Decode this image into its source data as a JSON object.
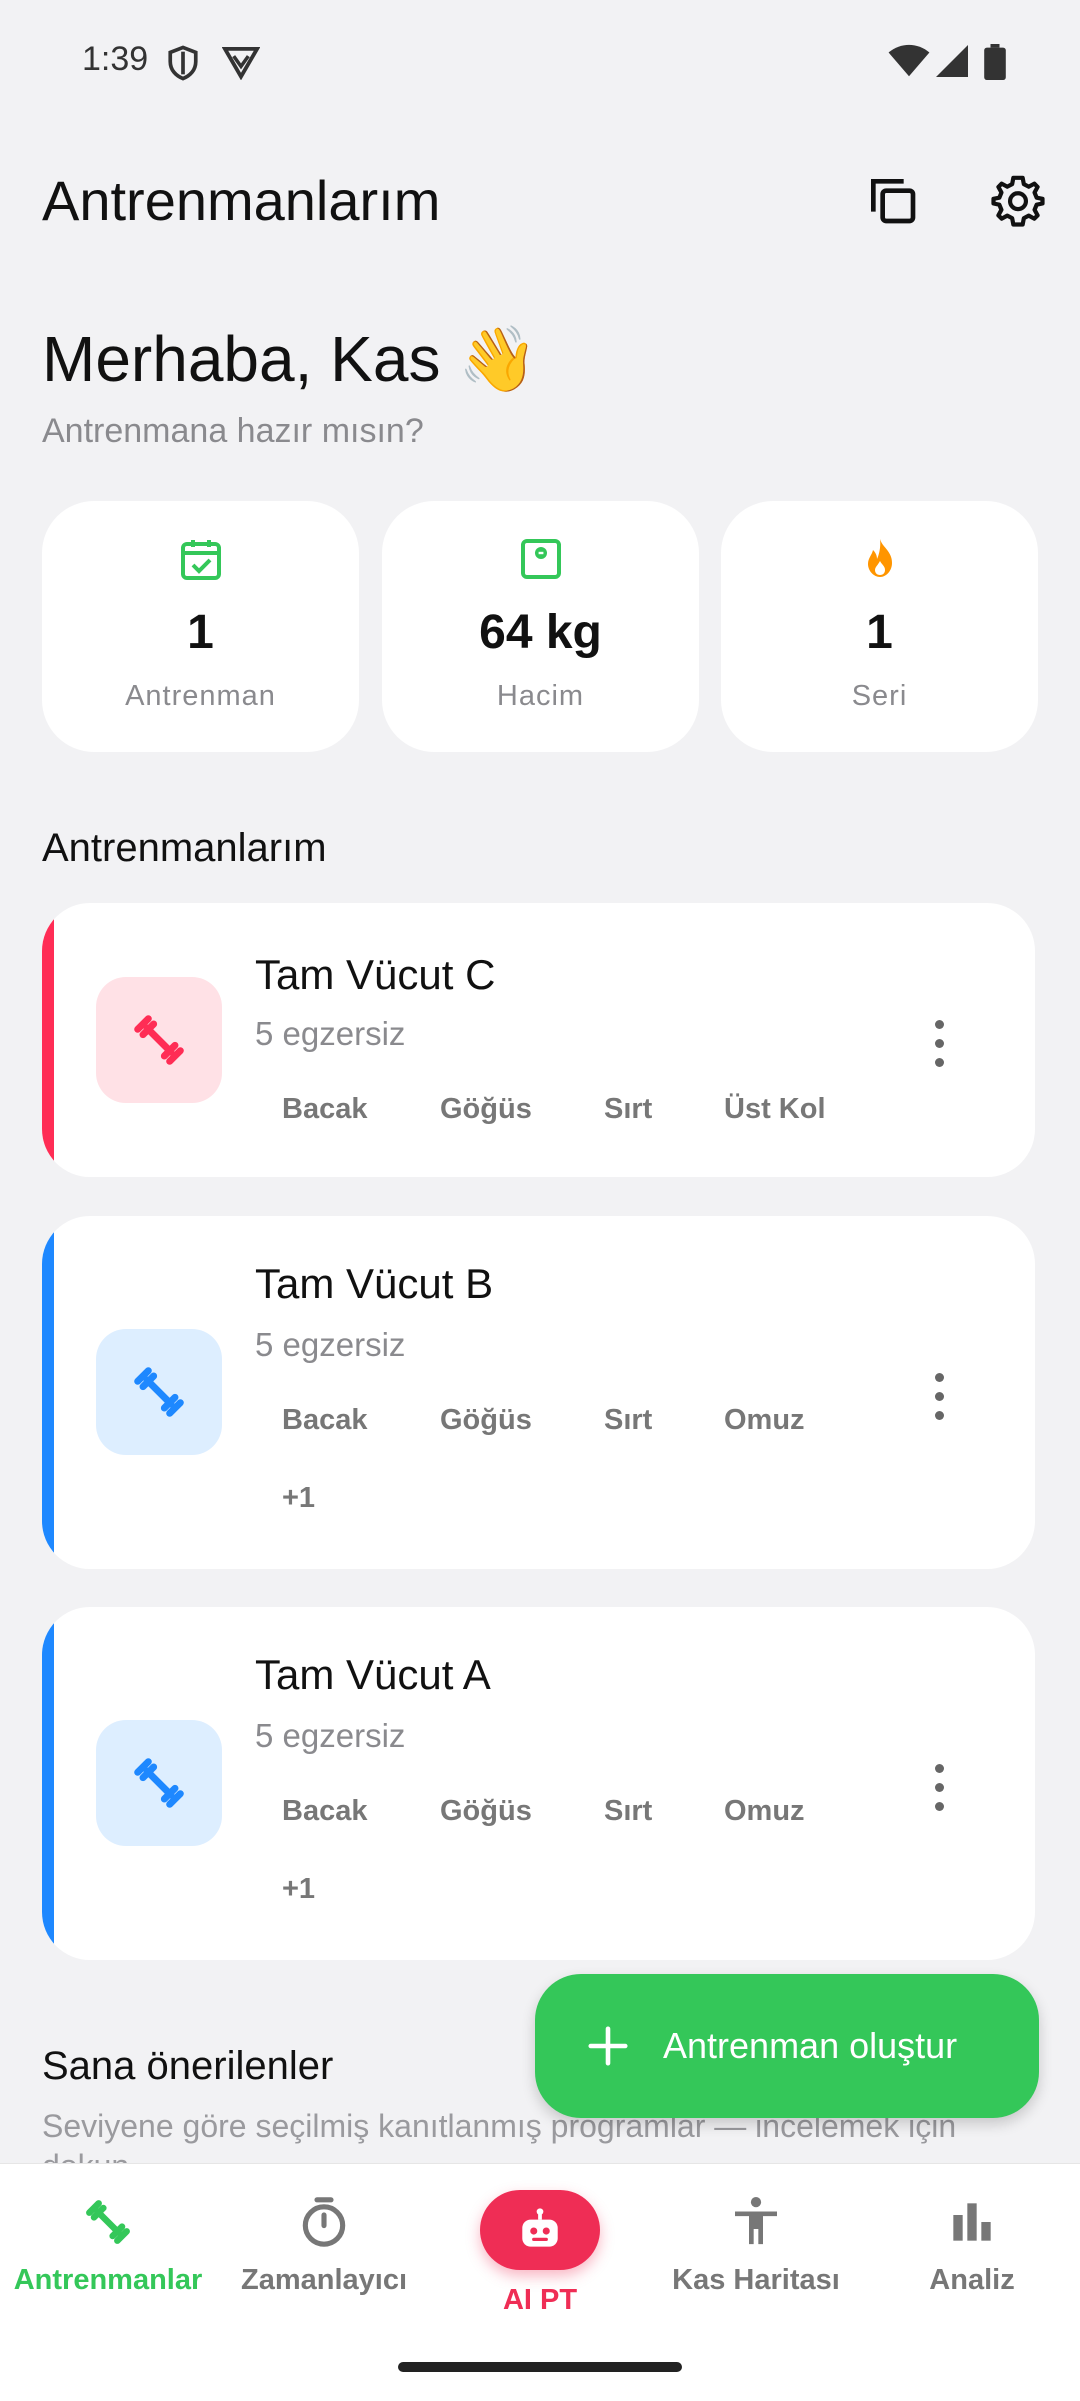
{
  "status_bar": {
    "time": "1:39"
  },
  "header": {
    "title": "Antrenmanlarım"
  },
  "greeting": {
    "title": "Merhaba, Kas 👋",
    "subtitle": "Antrenmana hazır mısın?"
  },
  "stats": [
    {
      "value": "1",
      "label": "Antrenman",
      "icon": "calendar-check-icon",
      "color": "#34c759"
    },
    {
      "value": "64 kg",
      "label": "Hacim",
      "icon": "scale-icon",
      "color": "#34c759"
    },
    {
      "value": "1",
      "label": "Seri",
      "icon": "flame-icon",
      "color": "#ff9500"
    }
  ],
  "workouts_section": {
    "title": "Antrenmanlarım"
  },
  "workouts": [
    {
      "name": "Tam Vücut C",
      "count": "5 egzersiz",
      "accent": "#ff2d55",
      "tags": [
        "Bacak",
        "Göğüs",
        "Sırt",
        "Üst Kol"
      ]
    },
    {
      "name": "Tam Vücut B",
      "count": "5 egzersiz",
      "accent": "#1e88ff",
      "tags": [
        "Bacak",
        "Göğüs",
        "Sırt",
        "Omuz"
      ],
      "extra": "+1"
    },
    {
      "name": "Tam Vücut A",
      "count": "5 egzersiz",
      "accent": "#1e88ff",
      "tags": [
        "Bacak",
        "Göğüs",
        "Sırt",
        "Omuz"
      ],
      "extra": "+1"
    }
  ],
  "suggestions": {
    "title": "Sana önerilenler",
    "subtitle": "Seviyene göre seçilmiş kanıtlanmış programlar — incelemek için dokun"
  },
  "fab": {
    "label": "Antrenman oluştur"
  },
  "bottom_nav": [
    {
      "label": "Antrenmanlar",
      "icon": "dumbbell-icon",
      "active": true
    },
    {
      "label": "Zamanlayıcı",
      "icon": "stopwatch-icon"
    },
    {
      "label": "AI PT",
      "icon": "robot-icon"
    },
    {
      "label": "Kas Haritası",
      "icon": "body-icon"
    },
    {
      "label": "Analiz",
      "icon": "bar-chart-icon"
    }
  ],
  "colors": {
    "active": "#34c759",
    "ai": "#ef2d55",
    "muted": "#8a8a8e"
  }
}
